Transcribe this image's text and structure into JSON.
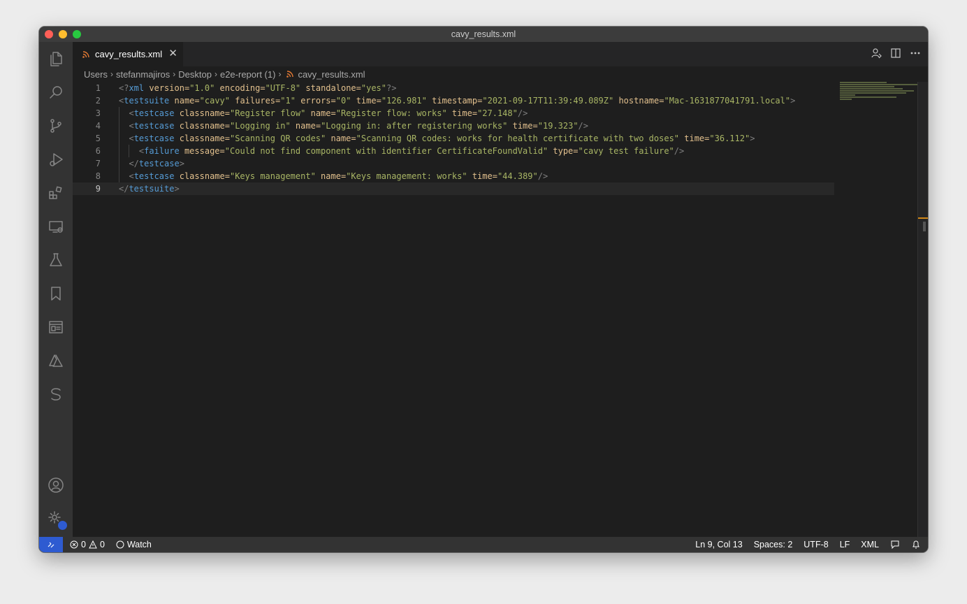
{
  "window": {
    "title": "cavy_results.xml"
  },
  "tab": {
    "label": "cavy_results.xml",
    "close": "✕"
  },
  "breadcrumb": [
    "Users",
    "stefanmajiros",
    "Desktop",
    "e2e-report (1)",
    "cavy_results.xml"
  ],
  "activity_icons": [
    "files-icon",
    "search-icon",
    "source-control-icon",
    "run-debug-icon",
    "extensions-icon",
    "remote-explorer-icon",
    "testing-icon",
    "bookmarks-icon",
    "panel-icon",
    "azure-icon",
    "s-icon",
    "accounts-icon",
    "manage-icon"
  ],
  "code": {
    "lines": [
      "<?xml version=\"1.0\" encoding=\"UTF-8\" standalone=\"yes\"?>",
      "<testsuite name=\"cavy\" failures=\"1\" errors=\"0\" time=\"126.981\" timestamp=\"2021-09-17T11:39:49.089Z\" hostname=\"Mac-1631877041791.local\">",
      "  <testcase classname=\"Register flow\" name=\"Register flow: works\" time=\"27.148\"/>",
      "  <testcase classname=\"Logging in\" name=\"Logging in: after registering works\" time=\"19.323\"/>",
      "  <testcase classname=\"Scanning QR codes\" name=\"Scanning QR codes: works for health certificate with two doses\" time=\"36.112\">",
      "    <failure message=\"Could not find component with identifier CertificateFoundValid\" type=\"cavy test failure\"/>",
      "  </testcase>",
      "  <testcase classname=\"Keys management\" name=\"Keys management: works\" time=\"44.389\"/>",
      "</testsuite>"
    ],
    "line_numbers": [
      "1",
      "2",
      "3",
      "4",
      "5",
      "6",
      "7",
      "8",
      "9"
    ],
    "current_line": 9
  },
  "statusbar": {
    "errors": "0",
    "warnings": "0",
    "watch": "Watch",
    "position": "Ln 9, Col 13",
    "spaces": "Spaces: 2",
    "encoding": "UTF-8",
    "eol": "LF",
    "language": "XML"
  },
  "colors": {
    "tag": "#569cd6",
    "attribute": "#e2c08d",
    "value": "#a9b665",
    "remote": "#2e5bd1"
  }
}
